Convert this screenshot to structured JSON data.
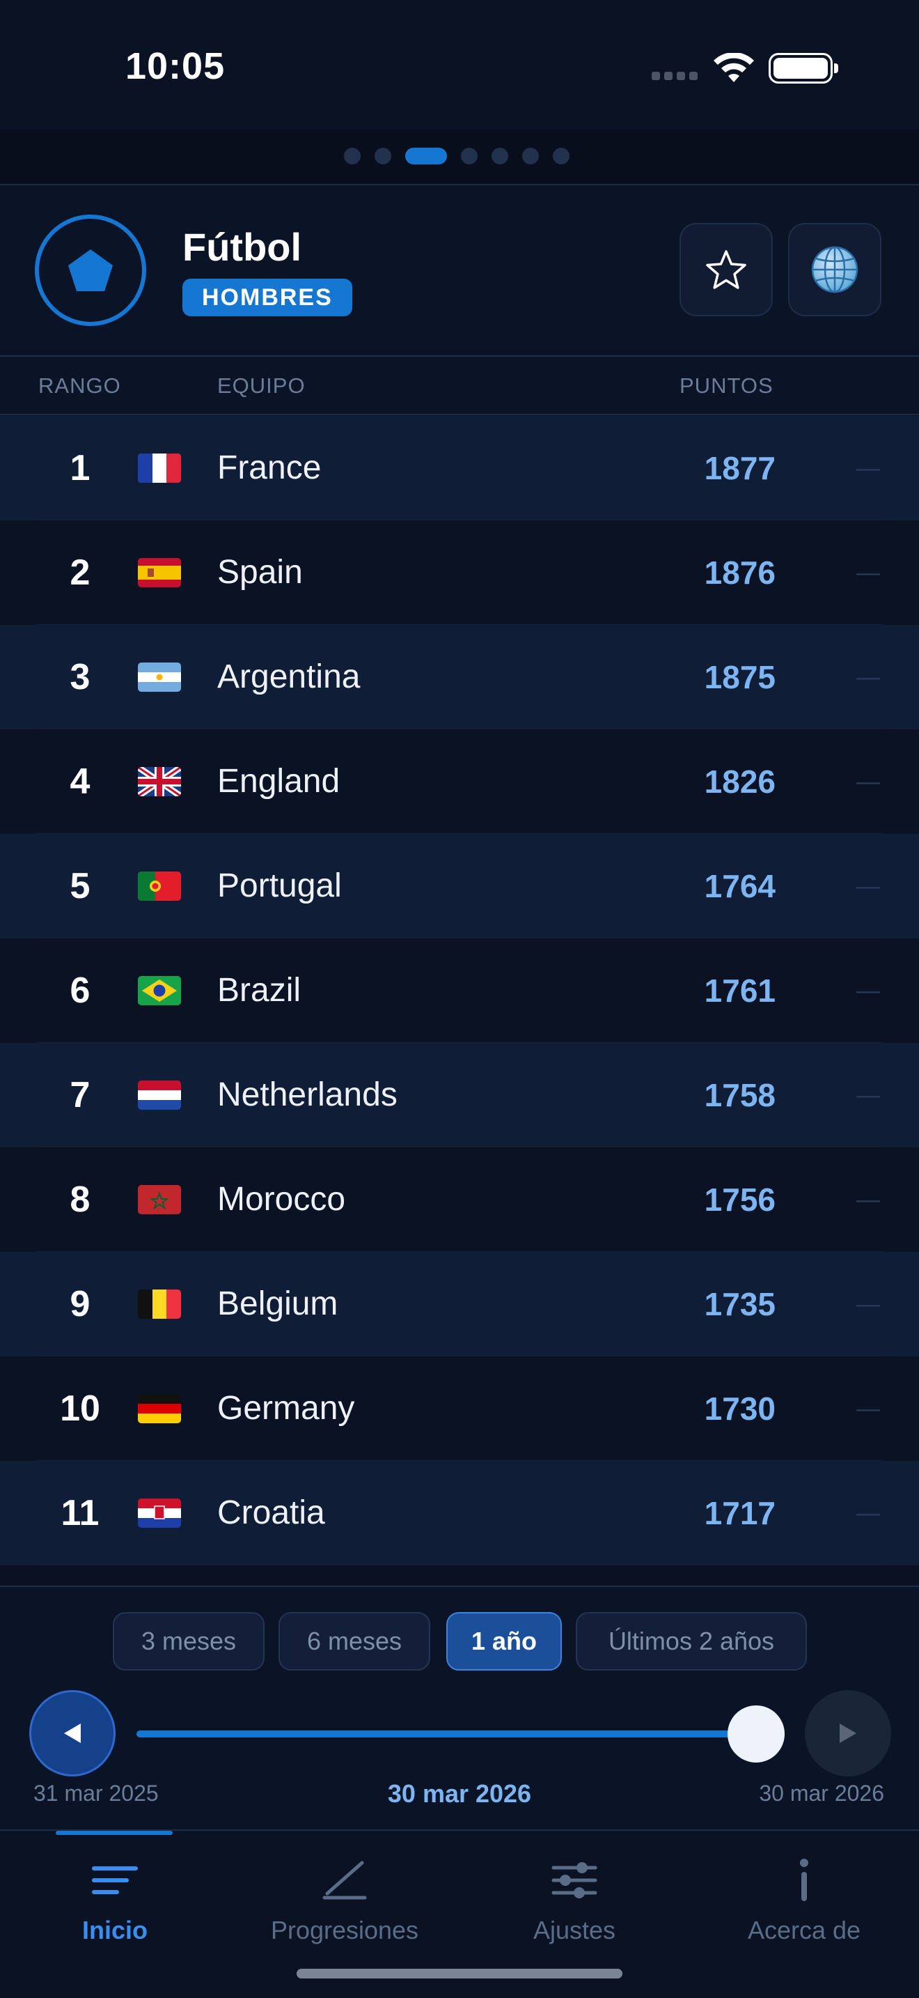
{
  "status_bar": {
    "time": "10:05"
  },
  "pager": {
    "page_count": 7,
    "active_index": 2
  },
  "header": {
    "sport_icon": "pentagon-icon",
    "title": "Fútbol",
    "gender": "HOMBRES",
    "favorite_icon": "star-icon",
    "globe_icon": "globe-icon"
  },
  "table": {
    "columns": {
      "rank": "RANGO",
      "team": "EQUIPO",
      "points": "PUNTOS"
    },
    "rows": [
      {
        "rank": "1",
        "team": "France",
        "points": "1877",
        "trend": "—",
        "flag": "france"
      },
      {
        "rank": "2",
        "team": "Spain",
        "points": "1876",
        "trend": "—",
        "flag": "spain"
      },
      {
        "rank": "3",
        "team": "Argentina",
        "points": "1875",
        "trend": "—",
        "flag": "argentina"
      },
      {
        "rank": "4",
        "team": "England",
        "points": "1826",
        "trend": "—",
        "flag": "england"
      },
      {
        "rank": "5",
        "team": "Portugal",
        "points": "1764",
        "trend": "—",
        "flag": "portugal"
      },
      {
        "rank": "6",
        "team": "Brazil",
        "points": "1761",
        "trend": "—",
        "flag": "brazil"
      },
      {
        "rank": "7",
        "team": "Netherlands",
        "points": "1758",
        "trend": "—",
        "flag": "netherlands"
      },
      {
        "rank": "8",
        "team": "Morocco",
        "points": "1756",
        "trend": "—",
        "flag": "morocco"
      },
      {
        "rank": "9",
        "team": "Belgium",
        "points": "1735",
        "trend": "—",
        "flag": "belgium"
      },
      {
        "rank": "10",
        "team": "Germany",
        "points": "1730",
        "trend": "—",
        "flag": "germany"
      },
      {
        "rank": "11",
        "team": "Croatia",
        "points": "1717",
        "trend": "—",
        "flag": "croatia"
      }
    ]
  },
  "period": {
    "options": [
      "3 meses",
      "6 meses",
      "1 año",
      "Últimos 2 años"
    ],
    "selected": "1 año",
    "start_date": "31 mar 2025",
    "current_date": "30 mar 2026",
    "end_date": "30 mar 2026",
    "slider_fraction": 1.0
  },
  "tabs": [
    {
      "label": "Inicio",
      "icon": "list-icon",
      "active": true
    },
    {
      "label": "Progresiones",
      "icon": "chart-icon",
      "active": false
    },
    {
      "label": "Ajustes",
      "icon": "sliders-icon",
      "active": false
    },
    {
      "label": "Acerca de",
      "icon": "info-icon",
      "active": false
    }
  ],
  "colors": {
    "accent": "#1677d2",
    "points": "#7db4f2",
    "background": "#0a1122"
  }
}
